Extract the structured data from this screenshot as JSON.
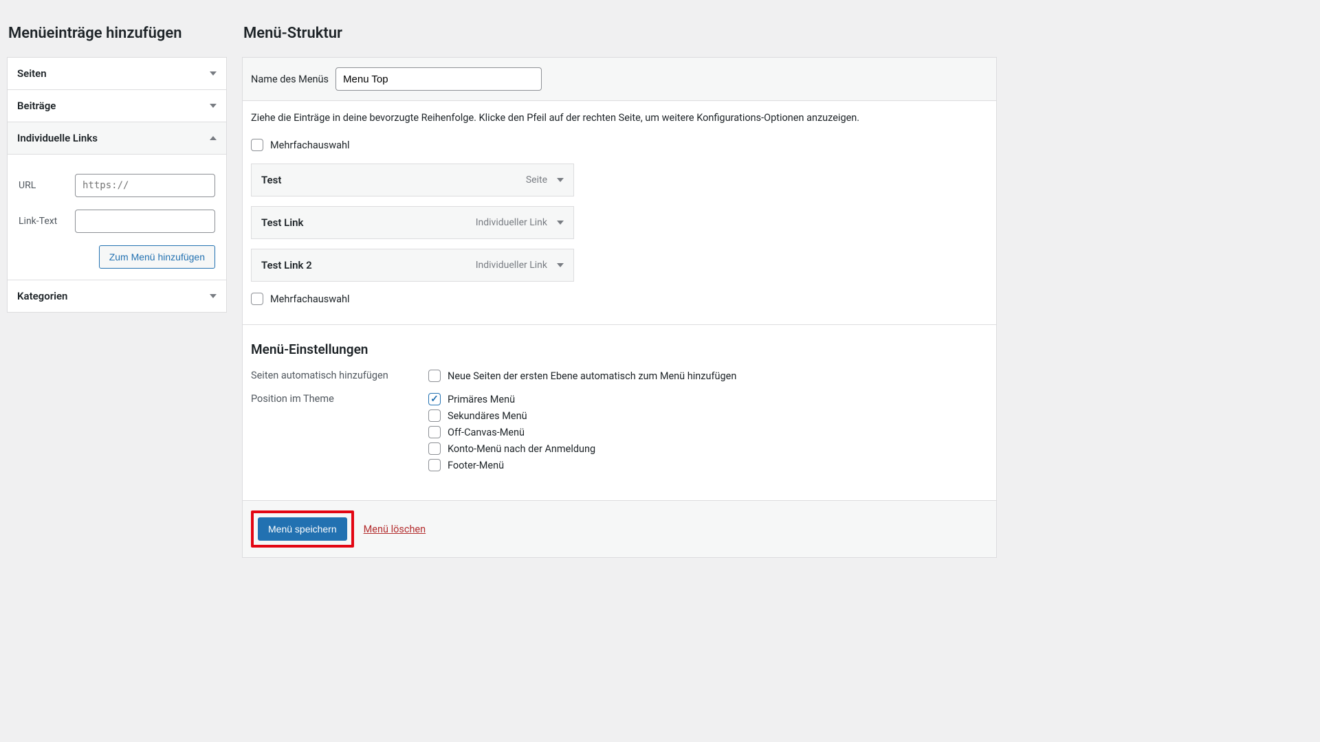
{
  "left": {
    "heading": "Menüeinträge hinzufügen",
    "panels": {
      "pages": "Seiten",
      "posts": "Beiträge",
      "custom_links": "Individuelle Links",
      "categories": "Kategorien"
    },
    "custom": {
      "url_label": "URL",
      "url_placeholder": "https://",
      "text_label": "Link-Text",
      "add_button": "Zum Menü hinzufügen"
    }
  },
  "right": {
    "heading": "Menü-Struktur",
    "name_label": "Name des Menüs",
    "name_value": "Menu Top",
    "instructions": "Ziehe die Einträge in deine bevorzugte Reihenfolge. Klicke den Pfeil auf der rechten Seite, um weitere Konfigurations-Optionen anzuzeigen.",
    "bulk_label": "Mehrfachauswahl",
    "items": [
      {
        "title": "Test",
        "type": "Seite"
      },
      {
        "title": "Test Link",
        "type": "Individueller Link"
      },
      {
        "title": "Test Link 2",
        "type": "Individueller Link"
      }
    ],
    "settings": {
      "heading": "Menü-Einstellungen",
      "auto_add_label": "Seiten automatisch hinzufügen",
      "auto_add_option": "Neue Seiten der ersten Ebene automatisch zum Menü hinzufügen",
      "location_label": "Position im Theme",
      "locations": [
        {
          "label": "Primäres Menü",
          "checked": true
        },
        {
          "label": "Sekundäres Menü",
          "checked": false
        },
        {
          "label": "Off-Canvas-Menü",
          "checked": false
        },
        {
          "label": "Konto-Menü nach der Anmeldung",
          "checked": false
        },
        {
          "label": "Footer-Menü",
          "checked": false
        }
      ]
    },
    "save_button": "Menü speichern",
    "delete_link": "Menü löschen"
  }
}
